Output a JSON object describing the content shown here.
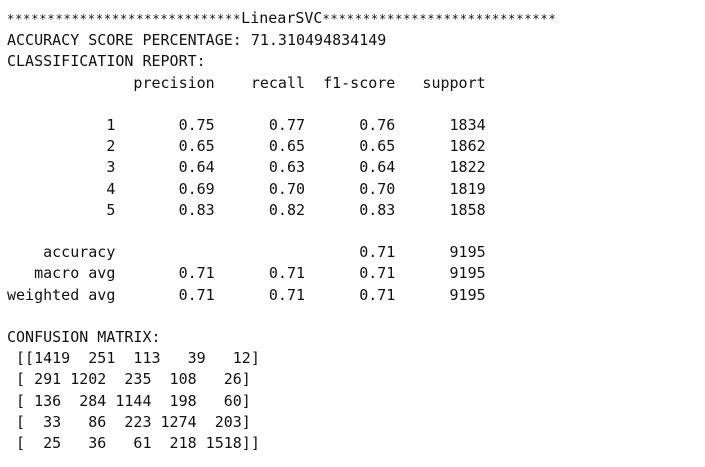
{
  "header": {
    "stars_left": "*****************************",
    "model_name": "LinearSVC",
    "stars_right": "*****************************"
  },
  "accuracy_line": "ACCURACY SCORE PERCENTAGE: 71.310494834149",
  "report": {
    "title": "CLASSIFICATION REPORT:",
    "header_row": "              precision    recall  f1-score   support",
    "class_rows": [
      "           1       0.75      0.77      0.76      1834",
      "           2       0.65      0.65      0.65      1862",
      "           3       0.64      0.63      0.64      1822",
      "           4       0.69      0.70      0.70      1819",
      "           5       0.83      0.82      0.83      1858"
    ],
    "summary_rows": [
      "    accuracy                           0.71      9195",
      "   macro avg       0.71      0.71      0.71      9195",
      "weighted avg       0.71      0.71      0.71      9195"
    ]
  },
  "confusion": {
    "title": "CONFUSION MATRIX:",
    "rows": [
      " [[1419  251  113   39   12]",
      " [ 291 1202  235  108   26]",
      " [ 136  284 1144  198   60]",
      " [  33   86  223 1274  203]",
      " [  25   36   61  218 1518]]"
    ]
  }
}
